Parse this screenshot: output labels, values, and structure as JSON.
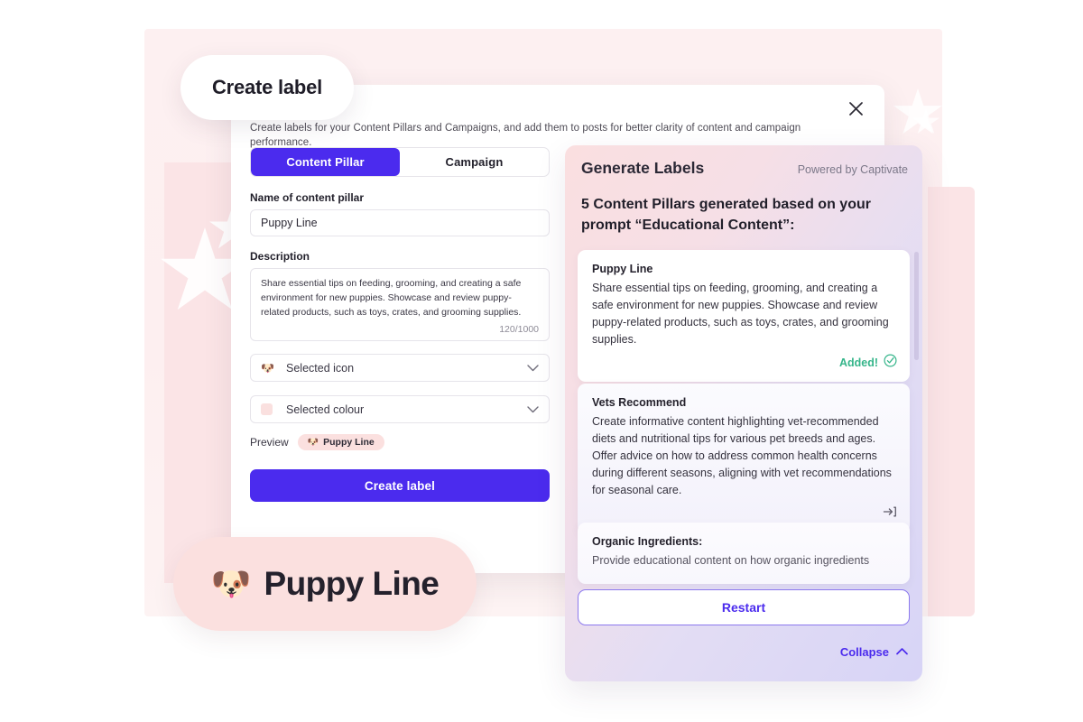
{
  "title_pill": {
    "label": "Create label"
  },
  "modal": {
    "close_icon": "close-icon",
    "intro": "Create labels for your Content Pillars and Campaigns, and add them to posts for better clarity of content and campaign performance.",
    "tabs": [
      {
        "label": "Content Pillar",
        "active": true
      },
      {
        "label": "Campaign",
        "active": false
      }
    ],
    "name_field": {
      "label": "Name of content pillar",
      "value": "Puppy Line",
      "placeholder": "Name of content pillar"
    },
    "description_field": {
      "label": "Description",
      "value": "Share essential tips on feeding, grooming, and creating a safe environment for new puppies. Showcase and review puppy-related products, such as toys, crates, and grooming supplies.",
      "counter": "120/1000"
    },
    "icon_select": {
      "value": "Selected icon",
      "icon": "dog-face-emoji",
      "chevron": "chevron-down-icon"
    },
    "colour_select": {
      "value": "Selected colour",
      "swatch": "#fae0df",
      "chevron": "chevron-down-icon"
    },
    "preview": {
      "label": "Preview",
      "pill_text": "Puppy Line",
      "pill_emoji": "🐶",
      "pill_bg": "#fbe0df"
    },
    "primary_button": {
      "label": "Create label",
      "color": "#4b2bee"
    }
  },
  "big_pill": {
    "emoji": "🐶",
    "text": "Puppy Line",
    "bg": "#fbe0df"
  },
  "ai_panel": {
    "heading": "Generate Labels",
    "powered_by": "Powered by Captivate",
    "subheading": "5 Content Pillars generated based on your prompt “Educational Content”:",
    "cards": [
      {
        "title": "Puppy Line",
        "body": "Share essential tips on feeding, grooming, and creating a safe environment for new puppies. Showcase and review puppy-related products, such as toys, crates, and grooming supplies.",
        "status": "Added!",
        "status_color": "#35b58a",
        "status_icon": "check-circle-icon"
      },
      {
        "title": "Vets Recommend",
        "body": "Create informative content highlighting vet-recommended diets and nutritional tips for various pet breeds and ages. Offer advice on how to address common health concerns during different seasons, aligning with vet recommendations for seasonal care.",
        "action_icon": "arrow-into-bracket-icon"
      },
      {
        "title": "Organic Ingredients:",
        "body": "Provide educational content on how organic ingredients"
      }
    ],
    "restart_button": {
      "label": "Restart",
      "color": "#4b2bee"
    },
    "collapse": {
      "label": "Collapse",
      "icon": "chevron-up-icon"
    }
  }
}
